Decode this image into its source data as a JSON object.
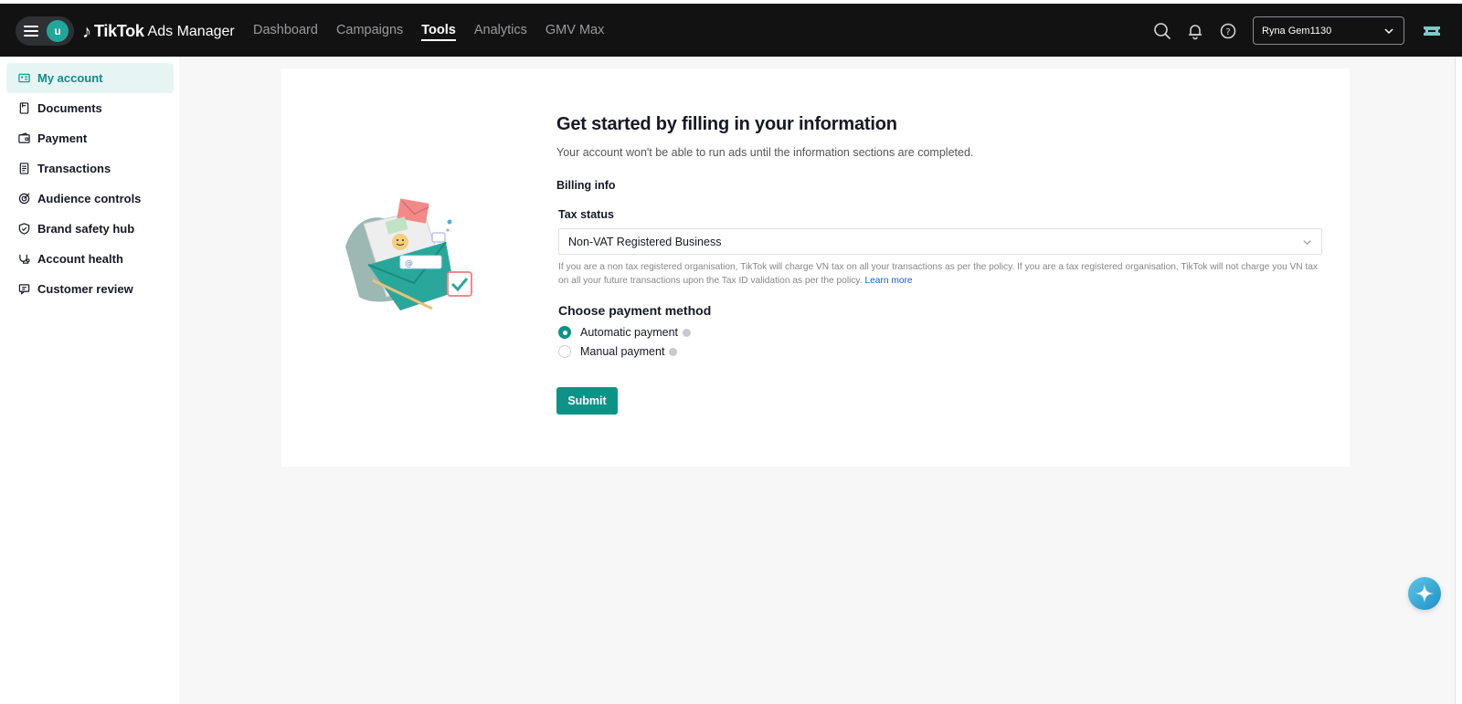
{
  "topbar": {
    "user_initial": "u",
    "logo_brand": "TikTok",
    "logo_product": "Ads Manager",
    "nav": [
      {
        "label": "Dashboard",
        "active": false
      },
      {
        "label": "Campaigns",
        "active": false
      },
      {
        "label": "Tools",
        "active": true
      },
      {
        "label": "Analytics",
        "active": false
      },
      {
        "label": "GMV Max",
        "active": false
      }
    ],
    "account_name": "Ryna Gem1130"
  },
  "sidebar": {
    "items": [
      {
        "label": "My account",
        "icon": "id-card-icon",
        "active": true
      },
      {
        "label": "Documents",
        "icon": "document-icon",
        "active": false
      },
      {
        "label": "Payment",
        "icon": "wallet-icon",
        "active": false
      },
      {
        "label": "Transactions",
        "icon": "receipt-icon",
        "active": false
      },
      {
        "label": "Audience controls",
        "icon": "target-icon",
        "active": false
      },
      {
        "label": "Brand safety hub",
        "icon": "shield-icon",
        "active": false
      },
      {
        "label": "Account health",
        "icon": "health-icon",
        "active": false
      },
      {
        "label": "Customer review",
        "icon": "comment-icon",
        "active": false
      }
    ]
  },
  "form": {
    "title": "Get started by filling in your information",
    "subtitle": "Your account won't be able to run ads until the information sections are completed.",
    "billing_label": "Billing info",
    "tax_status_label": "Tax status",
    "tax_status_value": "Non-VAT Registered Business",
    "tax_help": "If you are a non tax registered organisation, TikTok will charge VN tax on all your transactions as per the policy. If you are a tax registered organisation, TikTok will not charge you VN tax on all your future transactions upon the Tax ID validation as per the policy.",
    "learn_more": "Learn more",
    "payment_method_title": "Choose payment method",
    "payment_options": [
      {
        "label": "Automatic payment",
        "selected": true
      },
      {
        "label": "Manual payment",
        "selected": false
      }
    ],
    "submit_label": "Submit"
  },
  "colors": {
    "accent": "#0b9486",
    "topbar": "#121212",
    "sidebar_active_bg": "#e6f5f3"
  }
}
